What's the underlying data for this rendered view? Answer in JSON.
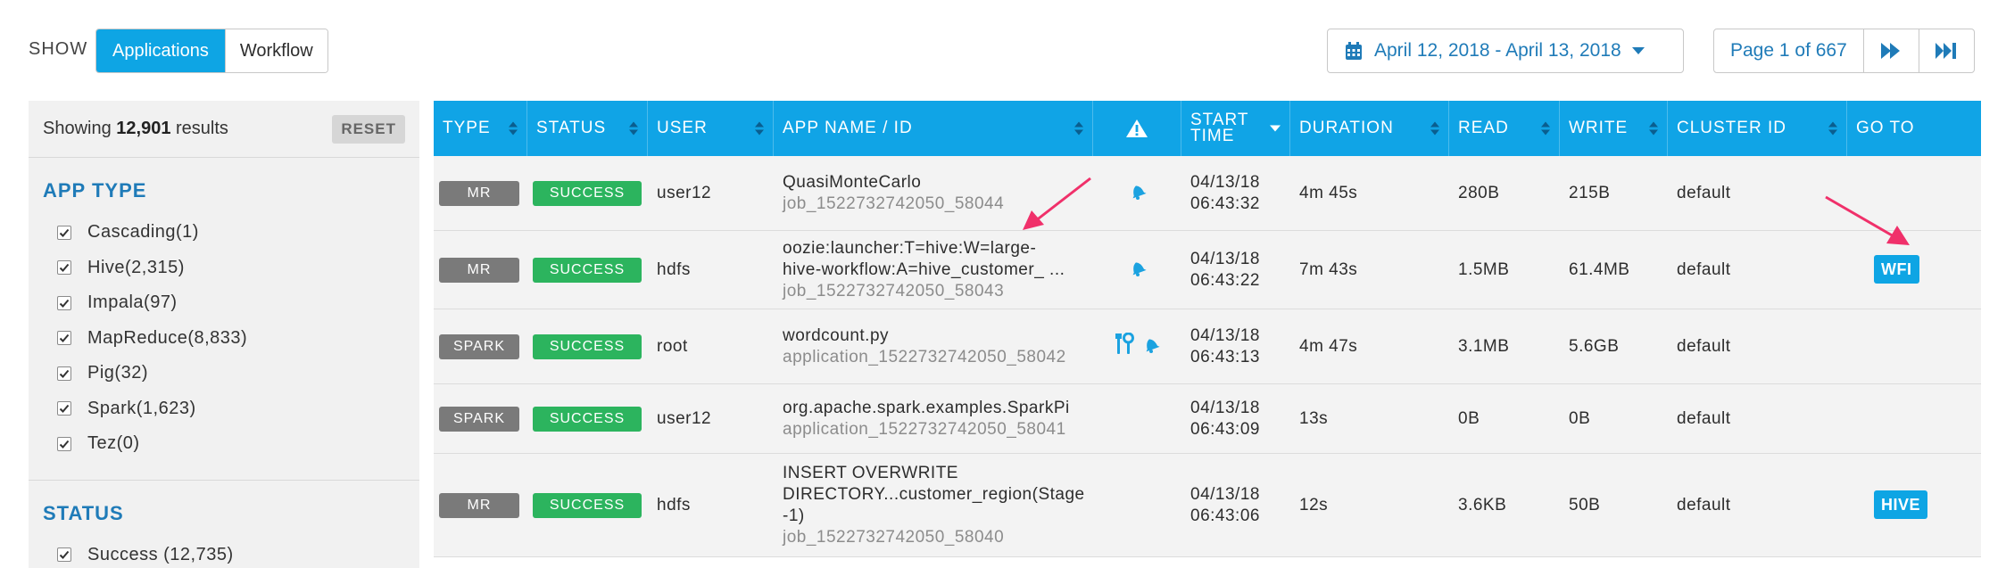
{
  "topbar": {
    "show_label": "SHOW",
    "view_options": [
      "Applications",
      "Workflow"
    ],
    "date_range": "April 12, 2018 - April 13, 2018",
    "page_label": "Page 1 of 667"
  },
  "sidebar": {
    "showing_prefix": "Showing",
    "result_count": "12,901",
    "showing_suffix": "results",
    "reset_label": "RESET",
    "app_type": {
      "title": "APP TYPE",
      "items": [
        "Cascading(1)",
        "Hive(2,315)",
        "Impala(97)",
        "MapReduce(8,833)",
        "Pig(32)",
        "Spark(1,623)",
        "Tez(0)"
      ]
    },
    "status": {
      "title": "STATUS",
      "items": [
        "Success (12,735)"
      ]
    }
  },
  "table": {
    "columns": [
      "TYPE",
      "STATUS",
      "USER",
      "APP NAME / ID",
      "",
      "START TIME",
      "DURATION",
      "READ",
      "WRITE",
      "CLUSTER ID",
      "GO TO"
    ],
    "rows": [
      {
        "type": "MR",
        "status": "SUCCESS",
        "user": "user12",
        "name_lines": [
          "QuasiMonteCarlo"
        ],
        "id": "job_1522732742050_58044",
        "icons": [
          "bell"
        ],
        "start_date": "04/13/18",
        "start_time": "06:43:32",
        "duration": "4m 45s",
        "read": "280B",
        "write": "215B",
        "cluster": "default",
        "goto": ""
      },
      {
        "type": "MR",
        "status": "SUCCESS",
        "user": "hdfs",
        "name_lines": [
          "oozie:launcher:T=hive:W=large-",
          "hive-workflow:A=hive_customer_ ..."
        ],
        "id": "job_1522732742050_58043",
        "icons": [
          "bell"
        ],
        "start_date": "04/13/18",
        "start_time": "06:43:22",
        "duration": "7m 43s",
        "read": "1.5MB",
        "write": "61.4MB",
        "cluster": "default",
        "goto": "WFI"
      },
      {
        "type": "SPARK",
        "status": "SUCCESS",
        "user": "root",
        "name_lines": [
          "wordcount.py"
        ],
        "id": "application_1522732742050_58042",
        "icons": [
          "tools",
          "bell"
        ],
        "start_date": "04/13/18",
        "start_time": "06:43:13",
        "duration": "4m 47s",
        "read": "3.1MB",
        "write": "5.6GB",
        "cluster": "default",
        "goto": ""
      },
      {
        "type": "SPARK",
        "status": "SUCCESS",
        "user": "user12",
        "name_lines": [
          "org.apache.spark.examples.SparkPi"
        ],
        "id": "application_1522732742050_58041",
        "icons": [],
        "start_date": "04/13/18",
        "start_time": "06:43:09",
        "duration": "13s",
        "read": "0B",
        "write": "0B",
        "cluster": "default",
        "goto": ""
      },
      {
        "type": "MR",
        "status": "SUCCESS",
        "user": "hdfs",
        "name_lines": [
          "INSERT OVERWRITE",
          "DIRECTORY...customer_region(Stage",
          "-1)"
        ],
        "id": "job_1522732742050_58040",
        "icons": [],
        "start_date": "04/13/18",
        "start_time": "06:43:06",
        "duration": "12s",
        "read": "3.6KB",
        "write": "50B",
        "cluster": "default",
        "goto": "HIVE"
      }
    ]
  },
  "colors": {
    "accent": "#0ea5e4",
    "header": "#10a4e6",
    "success": "#2cb45e",
    "type_badge": "#7a7a7a",
    "link": "#1f7bb8",
    "annotation_arrow": "#f0306a"
  }
}
